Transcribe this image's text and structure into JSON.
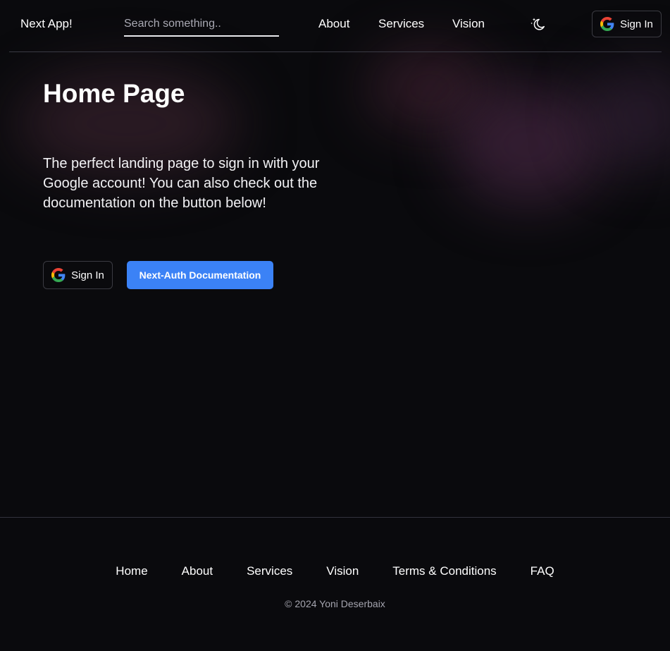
{
  "header": {
    "brand": "Next App!",
    "search_placeholder": "Search something..",
    "nav": [
      "About",
      "Services",
      "Vision"
    ],
    "theme_toggle_icon": "moon-stars-icon",
    "signin_label": "Sign In",
    "signin_icon": "google-icon"
  },
  "main": {
    "title": "Home Page",
    "description": "The perfect landing page to sign in with your Google account! You can also check out the documentation on the button below!",
    "signin_label": "Sign In",
    "docs_label": "Next-Auth Documentation"
  },
  "footer": {
    "links": [
      "Home",
      "About",
      "Services",
      "Vision",
      "Terms & Conditions",
      "FAQ"
    ],
    "copyright": "© 2024 Yoni Deserbaix"
  },
  "colors": {
    "background": "#0a0a0d",
    "accent": "#3b82f6",
    "text": "#ffffff",
    "muted": "#a4a4ae"
  }
}
